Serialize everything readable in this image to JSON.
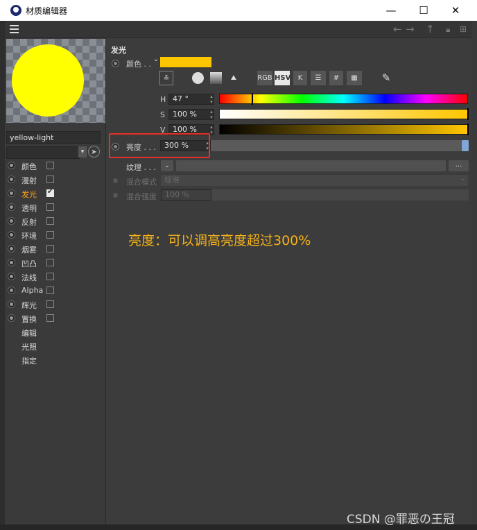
{
  "window": {
    "title": "材质编辑器",
    "minimize": "—",
    "maximize": "☐",
    "close": "✕"
  },
  "material": {
    "name": "yellow-light",
    "preview_color": "#ffff00"
  },
  "channels": [
    {
      "label": "颜色",
      "checked": false,
      "active": false,
      "has_radio": true,
      "has_box": true
    },
    {
      "label": "漫射",
      "checked": false,
      "active": false,
      "has_radio": true,
      "has_box": true
    },
    {
      "label": "发光",
      "checked": true,
      "active": true,
      "has_radio": true,
      "has_box": true
    },
    {
      "label": "透明",
      "checked": false,
      "active": false,
      "has_radio": true,
      "has_box": true
    },
    {
      "label": "反射",
      "checked": false,
      "active": false,
      "has_radio": true,
      "has_box": true
    },
    {
      "label": "环境",
      "checked": false,
      "active": false,
      "has_radio": true,
      "has_box": true
    },
    {
      "label": "烟雾",
      "checked": false,
      "active": false,
      "has_radio": true,
      "has_box": true
    },
    {
      "label": "凹凸",
      "checked": false,
      "active": false,
      "has_radio": true,
      "has_box": true
    },
    {
      "label": "法线",
      "checked": false,
      "active": false,
      "has_radio": true,
      "has_box": true
    },
    {
      "label": "Alpha",
      "checked": false,
      "active": false,
      "has_radio": true,
      "has_box": true
    },
    {
      "label": "辉光",
      "checked": false,
      "active": false,
      "has_radio": true,
      "has_box": true
    },
    {
      "label": "置换",
      "checked": false,
      "active": false,
      "has_radio": true,
      "has_box": true
    },
    {
      "label": "编辑",
      "checked": false,
      "active": false,
      "has_radio": false,
      "has_box": false
    },
    {
      "label": "光照",
      "checked": false,
      "active": false,
      "has_radio": false,
      "has_box": false
    },
    {
      "label": "指定",
      "checked": false,
      "active": false,
      "has_radio": false,
      "has_box": false
    }
  ],
  "luminance": {
    "section_title": "发光",
    "color_label": "颜色 . .",
    "color_value": "#ffc600",
    "mode_buttons": [
      "RGB",
      "HSV",
      "K",
      "#"
    ],
    "h_label": "H",
    "h_value": "47 °",
    "h_fraction": 0.131,
    "s_label": "S",
    "s_value": "100 %",
    "s_fraction": 1.0,
    "v_label": "V",
    "v_value": "100 %",
    "v_fraction": 1.0,
    "brightness_label": "亮度 . . .",
    "brightness_value": "300 %",
    "brightness_fraction": 1.0,
    "texture_label": "纹理 . . .",
    "texture_button": "...",
    "blend_mode_label": "混合模式",
    "blend_mode_value": "标准",
    "blend_strength_label": "混合强度",
    "blend_strength_value": "100 %"
  },
  "annotation": "亮度：可以调高亮度超过300%",
  "watermark": "CSDN @罪恶の王冠",
  "colors": {
    "accent": "#f7a21b",
    "highlight_box": "#e8302b"
  }
}
